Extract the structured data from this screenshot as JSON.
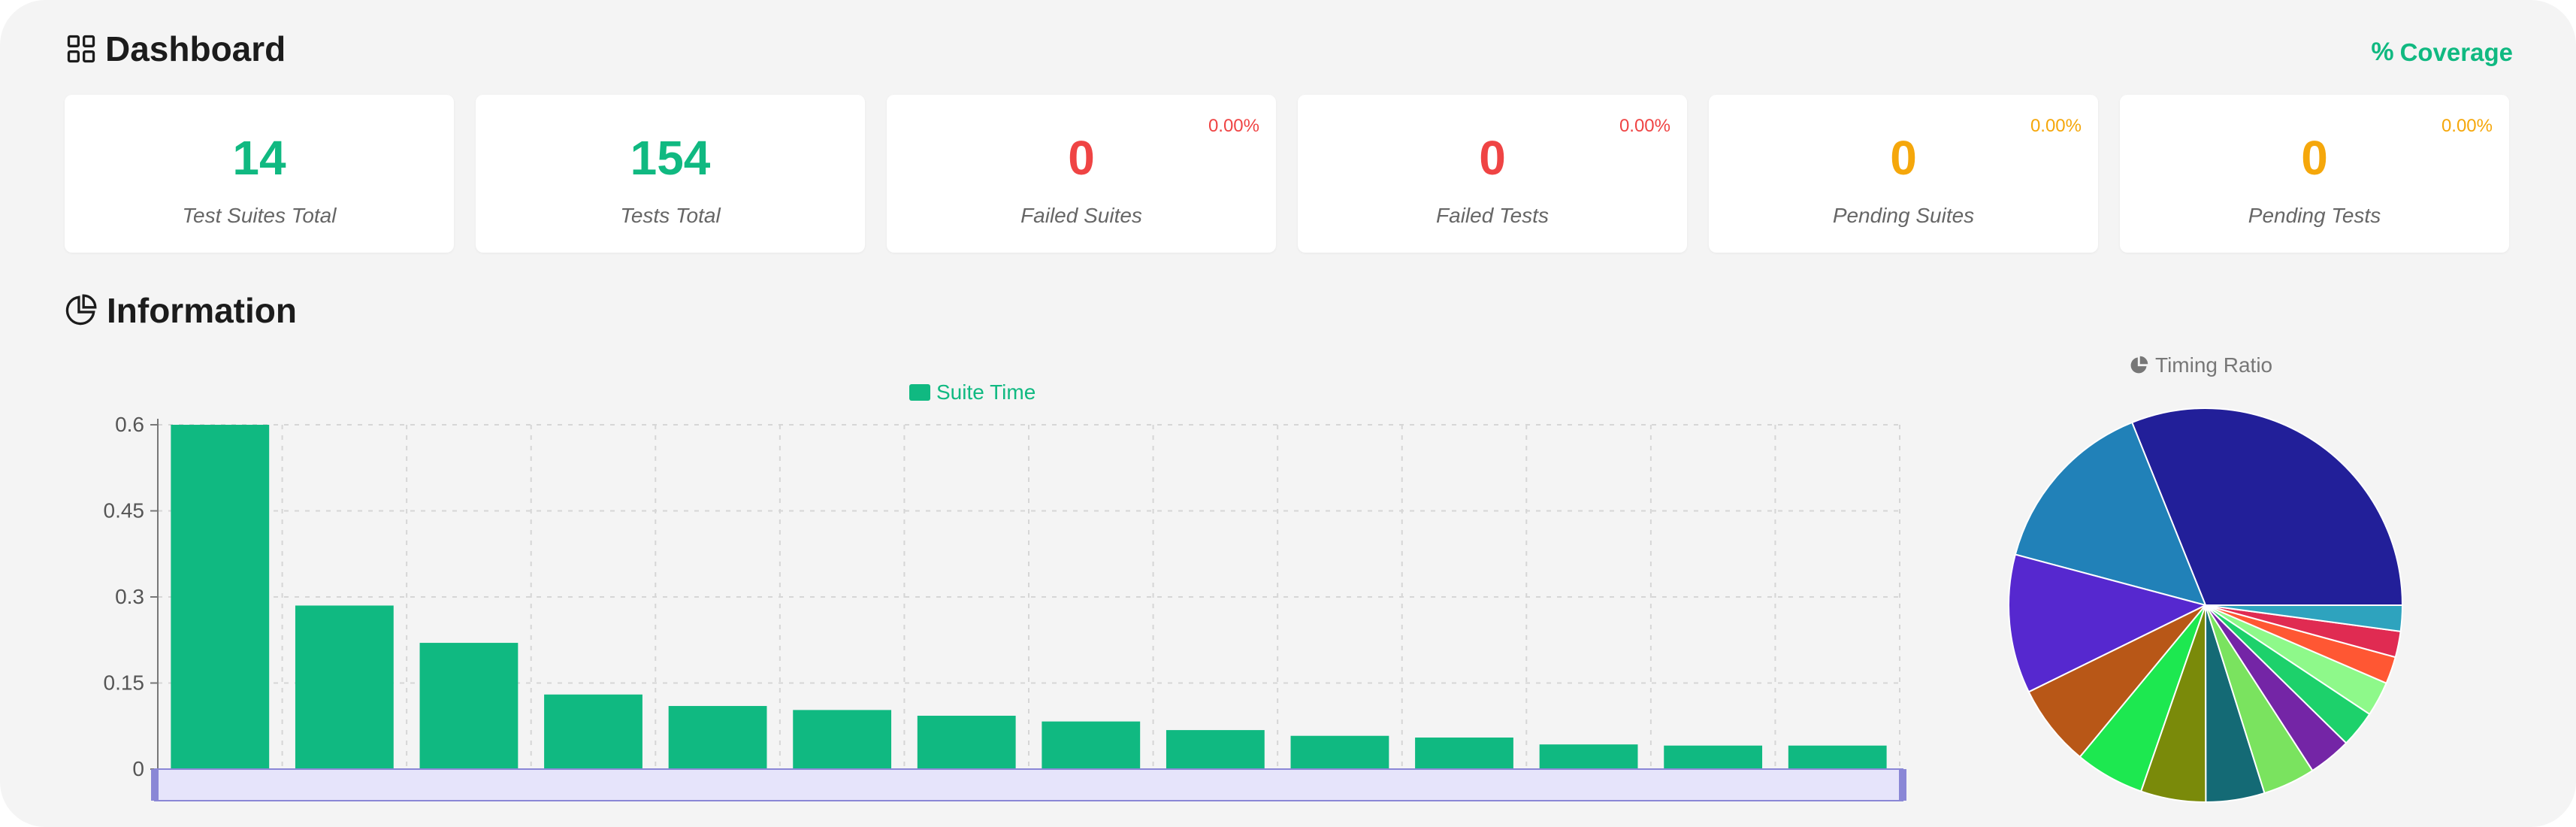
{
  "dashboard": {
    "title": "Dashboard",
    "coverage_label": "Coverage",
    "coverage_symbol": "%"
  },
  "cards": [
    {
      "value": "14",
      "label": "Test Suites Total",
      "badge": ""
    },
    {
      "value": "154",
      "label": "Tests Total",
      "badge": ""
    },
    {
      "value": "0",
      "label": "Failed Suites",
      "badge": "0.00%"
    },
    {
      "value": "0",
      "label": "Failed Tests",
      "badge": "0.00%"
    },
    {
      "value": "0",
      "label": "Pending Suites",
      "badge": "0.00%"
    },
    {
      "value": "0",
      "label": "Pending Tests",
      "badge": "0.00%"
    }
  ],
  "colors": {
    "green": "#10b981",
    "red": "#ef4444",
    "orange": "#f5a70b"
  },
  "information": {
    "title": "Information"
  },
  "chart_data": [
    {
      "type": "bar",
      "series": [
        {
          "name": "Suite Time",
          "values": [
            0.6,
            0.285,
            0.22,
            0.13,
            0.11,
            0.103,
            0.093,
            0.083,
            0.068,
            0.058,
            0.055,
            0.043,
            0.041,
            0.041
          ]
        }
      ],
      "y_ticks": [
        "0",
        "0.15",
        "0.3",
        "0.45",
        "0.6"
      ],
      "ylim": [
        0,
        0.6
      ],
      "grid": true,
      "legend_position": "top-center",
      "color": "#10b981",
      "data_zoom_slider": true
    },
    {
      "type": "pie",
      "title": "Timing Ratio",
      "slices": [
        {
          "value": 0.6,
          "color": "#221f99"
        },
        {
          "value": 0.285,
          "color": "#2181b8"
        },
        {
          "value": 0.22,
          "color": "#5628cf"
        },
        {
          "value": 0.13,
          "color": "#b85717"
        },
        {
          "value": 0.11,
          "color": "#1de850"
        },
        {
          "value": 0.103,
          "color": "#7a8a0a"
        },
        {
          "value": 0.093,
          "color": "#146a75"
        },
        {
          "value": 0.083,
          "color": "#7ae35f"
        },
        {
          "value": 0.068,
          "color": "#7425a6"
        },
        {
          "value": 0.058,
          "color": "#1dd16b"
        },
        {
          "value": 0.055,
          "color": "#8ef98a"
        },
        {
          "value": 0.043,
          "color": "#ff5733"
        },
        {
          "value": 0.041,
          "color": "#e02b52"
        },
        {
          "value": 0.041,
          "color": "#2ea3be"
        }
      ]
    }
  ]
}
